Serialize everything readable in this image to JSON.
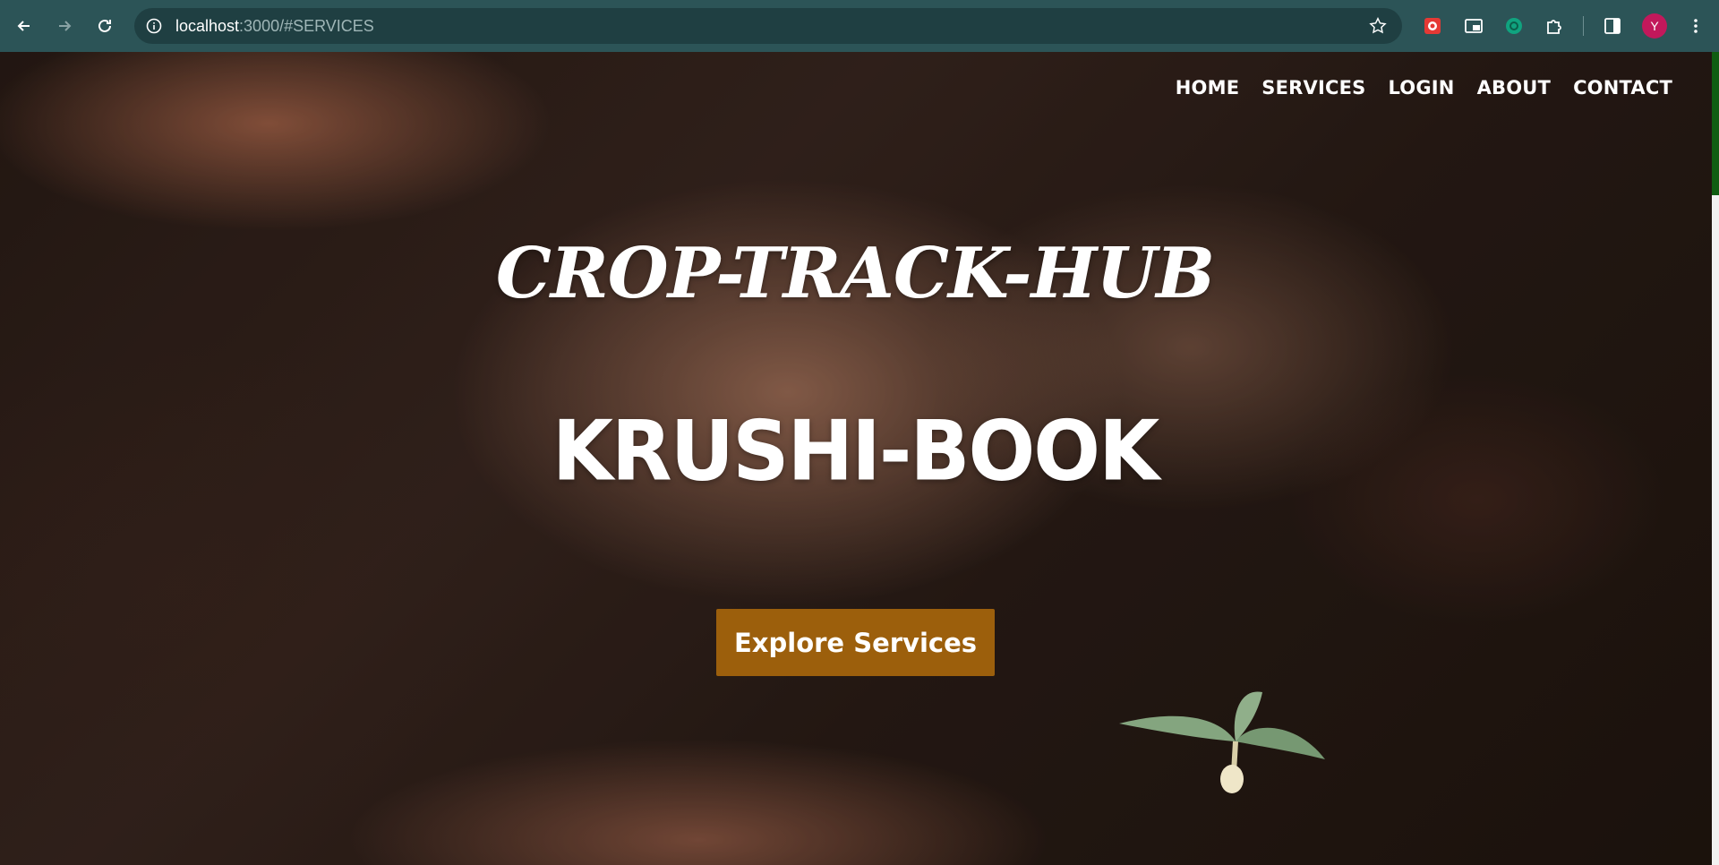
{
  "browser": {
    "url_host": "localhost",
    "url_rest": ":3000/#SERVICES",
    "profile_initial": "Y",
    "icons": [
      "back-arrow-icon",
      "forward-arrow-icon",
      "reload-icon",
      "site-info-icon",
      "bookmark-star-icon",
      "extension-icon",
      "cast-icon",
      "chatgpt-icon",
      "puzzle-icon",
      "sidepanel-icon",
      "menu-dots-icon"
    ]
  },
  "nav": {
    "items": [
      "HOME",
      "SERVICES",
      "LOGIN",
      "ABOUT",
      "CONTACT"
    ]
  },
  "hero": {
    "script_title": "CROP-TRACK-HUB",
    "main_title": "KRUSHI-BOOK",
    "cta_label": "Explore Services"
  },
  "colors": {
    "chrome": "#2c5457",
    "cta": "#9c5f0c",
    "scroll_thumb": "#0f5d12"
  }
}
